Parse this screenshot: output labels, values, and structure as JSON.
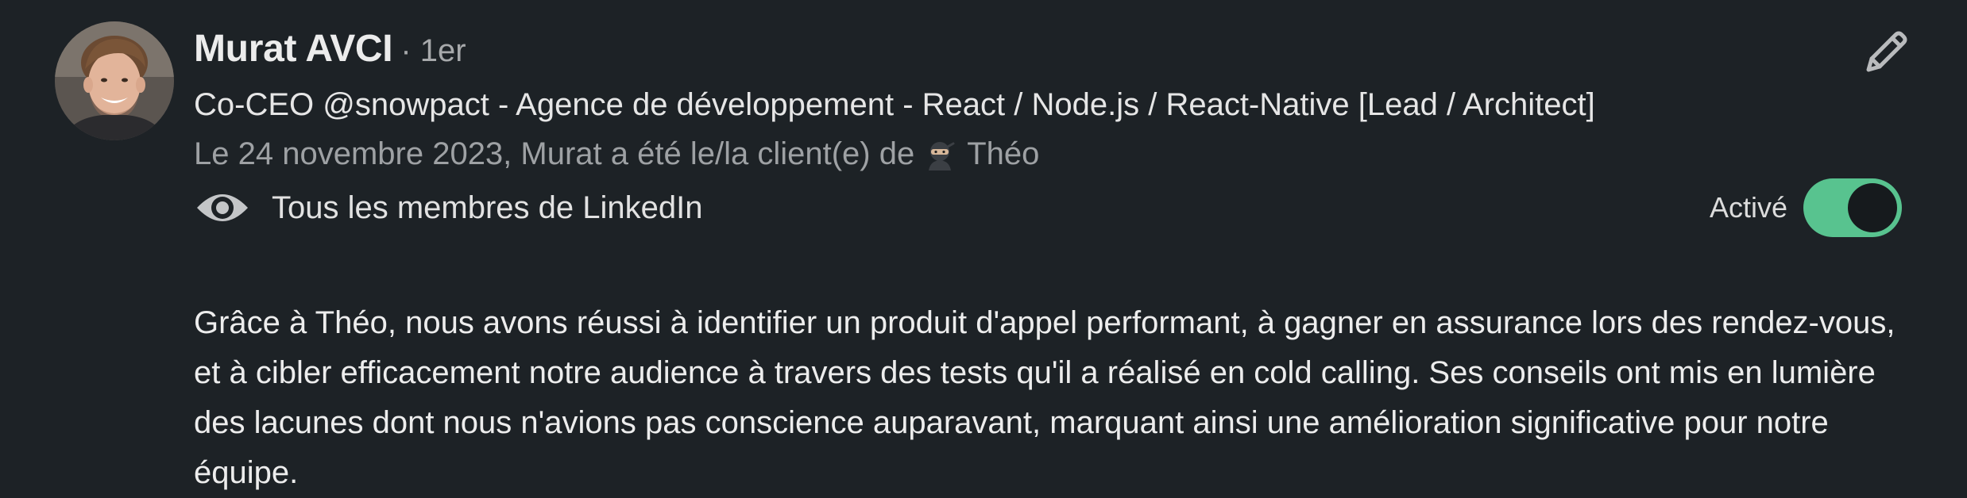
{
  "recommendation": {
    "author_name": "Murat AVCI",
    "connection_degree": "· 1er",
    "headline": "Co-CEO @snowpact - Agence de développement - React / Node.js / React-Native [Lead / Architect]",
    "date_line_prefix": "Le 24 novembre 2023, Murat a été le/la client(e) de",
    "date_line_recipient": "Théo",
    "visibility_icon": "eye-icon",
    "visibility_label": "Tous les membres de LinkedIn",
    "toggle_label": "Activé",
    "toggle_state": "on",
    "edit_icon": "pencil-icon",
    "body": "Grâce à Théo, nous avons réussi à identifier un produit d'appel performant, à gagner en assurance lors des rendez-vous, et à cibler efficacement notre audience à travers des tests qu'il a réalisé en cold calling. Ses conseils ont mis en lumière des lacunes dont nous n'avions pas conscience auparavant, marquant ainsi une amélioration significative pour notre équipe."
  },
  "colors": {
    "background": "#1d2226",
    "toggle_on": "#58c38f",
    "muted_text": "#9ea1a4"
  }
}
